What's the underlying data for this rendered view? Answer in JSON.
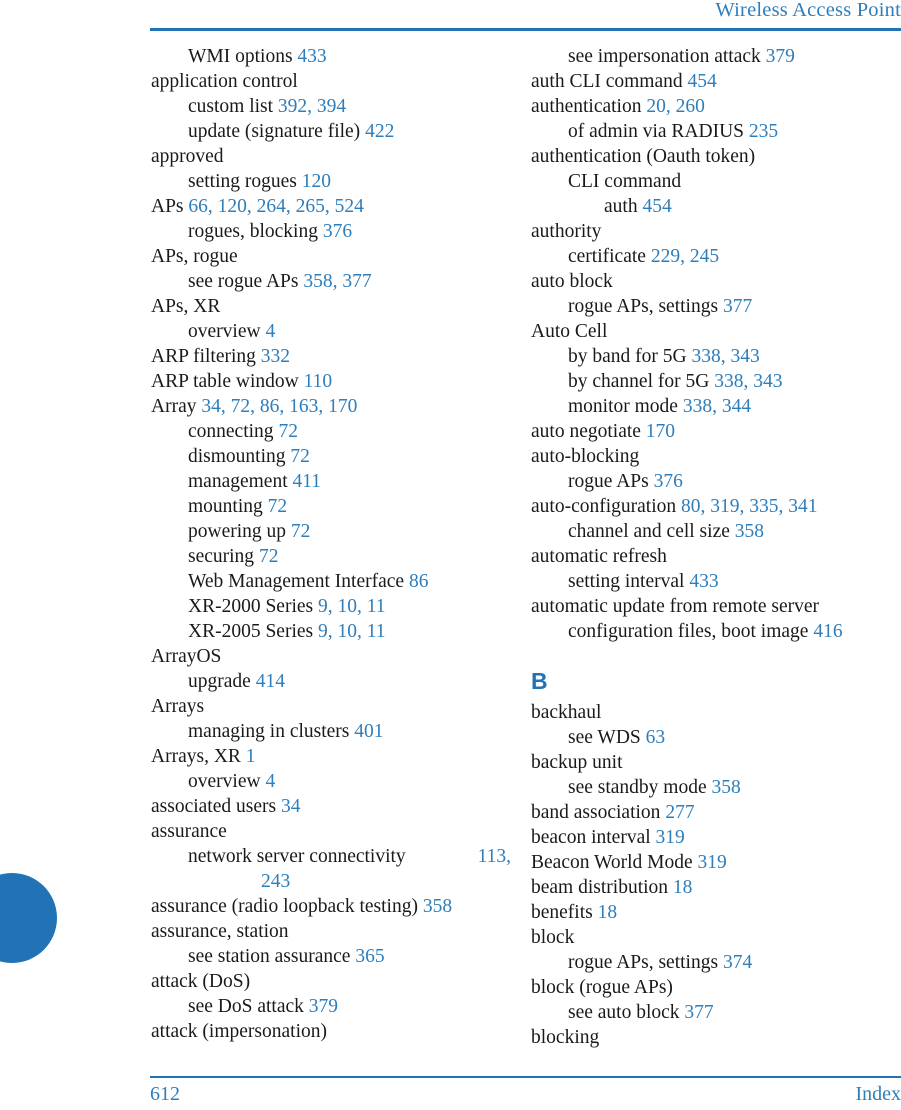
{
  "header": {
    "title": "Wireless Access Point"
  },
  "footer": {
    "page_number": "612",
    "label": "Index"
  },
  "colors": {
    "accent_blue": "#2273b5",
    "page_number_blue": "#2e7ebb",
    "body_text": "#1a1a1a"
  },
  "columns": {
    "left": [
      {
        "level": 1,
        "text": "WMI options ",
        "pages": "433"
      },
      {
        "level": 0,
        "text": "application control",
        "pages": ""
      },
      {
        "level": 1,
        "text": "custom list ",
        "pages": "392, 394"
      },
      {
        "level": 1,
        "text": "update (signature file) ",
        "pages": "422"
      },
      {
        "level": 0,
        "text": "approved",
        "pages": ""
      },
      {
        "level": 1,
        "text": "setting rogues ",
        "pages": "120"
      },
      {
        "level": 0,
        "text": "APs ",
        "pages": "66, 120, 264, 265, 524"
      },
      {
        "level": 1,
        "text": "rogues, blocking ",
        "pages": "376"
      },
      {
        "level": 0,
        "text": "APs, rogue",
        "pages": ""
      },
      {
        "level": 1,
        "text": "see rogue APs ",
        "pages": "358, 377"
      },
      {
        "level": 0,
        "text": "APs, XR",
        "pages": ""
      },
      {
        "level": 1,
        "text": "overview ",
        "pages": "4"
      },
      {
        "level": 0,
        "text": "ARP filtering ",
        "pages": "332"
      },
      {
        "level": 0,
        "text": "ARP table window ",
        "pages": "110"
      },
      {
        "level": 0,
        "text": "Array ",
        "pages": "34, 72, 86, 163, 170"
      },
      {
        "level": 1,
        "text": "connecting ",
        "pages": "72"
      },
      {
        "level": 1,
        "text": "dismounting ",
        "pages": "72"
      },
      {
        "level": 1,
        "text": "management ",
        "pages": "411"
      },
      {
        "level": 1,
        "text": "mounting ",
        "pages": "72"
      },
      {
        "level": 1,
        "text": "powering up ",
        "pages": "72"
      },
      {
        "level": 1,
        "text": "securing ",
        "pages": "72"
      },
      {
        "level": 1,
        "text": "Web Management Interface ",
        "pages": "86"
      },
      {
        "level": 1,
        "text": "XR-2000 Series ",
        "pages": "9, 10, 11"
      },
      {
        "level": 1,
        "text": "XR-2005 Series ",
        "pages": "9, 10, 11"
      },
      {
        "level": 0,
        "text": "ArrayOS",
        "pages": ""
      },
      {
        "level": 1,
        "text": "upgrade ",
        "pages": "414"
      },
      {
        "level": 0,
        "text": "Arrays",
        "pages": ""
      },
      {
        "level": 1,
        "text": "managing in clusters ",
        "pages": "401"
      },
      {
        "level": 0,
        "text": "Arrays, XR ",
        "pages": "1"
      },
      {
        "level": 1,
        "text": "overview ",
        "pages": "4"
      },
      {
        "level": 0,
        "text": "associated users ",
        "pages": "34"
      },
      {
        "level": 0,
        "text": "assurance",
        "pages": ""
      },
      {
        "level": 1,
        "justified": true,
        "text": "network server connectivity ",
        "pages": "113,",
        "continuation": "243"
      },
      {
        "level": 0,
        "text": "assurance (radio loopback testing) ",
        "pages": "358"
      },
      {
        "level": 0,
        "text": "assurance, station",
        "pages": ""
      },
      {
        "level": 1,
        "text": "see station assurance ",
        "pages": "365"
      },
      {
        "level": 0,
        "text": "attack (DoS)",
        "pages": ""
      },
      {
        "level": 1,
        "text": "see DoS attack ",
        "pages": "379"
      },
      {
        "level": 0,
        "text": "attack (impersonation)",
        "pages": ""
      }
    ],
    "right": [
      {
        "level": 1,
        "text": "see impersonation attack ",
        "pages": "379"
      },
      {
        "level": 0,
        "text": "auth CLI command ",
        "pages": "454"
      },
      {
        "level": 0,
        "text": "authentication ",
        "pages": "20, 260"
      },
      {
        "level": 1,
        "text": "of admin via RADIUS ",
        "pages": "235"
      },
      {
        "level": 0,
        "text": "authentication (Oauth token)",
        "pages": ""
      },
      {
        "level": 1,
        "text": "CLI command",
        "pages": ""
      },
      {
        "level": 2,
        "text": "auth ",
        "pages": "454"
      },
      {
        "level": 0,
        "text": "authority",
        "pages": ""
      },
      {
        "level": 1,
        "text": "certificate ",
        "pages": "229, 245"
      },
      {
        "level": 0,
        "text": "auto block",
        "pages": ""
      },
      {
        "level": 1,
        "text": "rogue APs, settings ",
        "pages": "377"
      },
      {
        "level": 0,
        "text": "Auto Cell",
        "pages": ""
      },
      {
        "level": 1,
        "text": "by band for 5G ",
        "pages": "338, 343"
      },
      {
        "level": 1,
        "text": "by channel for 5G ",
        "pages": "338, 343"
      },
      {
        "level": 1,
        "text": "monitor mode ",
        "pages": "338, 344"
      },
      {
        "level": 0,
        "text": "auto negotiate ",
        "pages": "170"
      },
      {
        "level": 0,
        "text": "auto-blocking",
        "pages": ""
      },
      {
        "level": 1,
        "text": "rogue APs ",
        "pages": "376"
      },
      {
        "level": 0,
        "text": "auto-configuration ",
        "pages": "80, 319, 335, 341"
      },
      {
        "level": 1,
        "text": "channel and cell size ",
        "pages": "358"
      },
      {
        "level": 0,
        "text": "automatic refresh",
        "pages": ""
      },
      {
        "level": 1,
        "text": "setting interval ",
        "pages": "433"
      },
      {
        "level": 0,
        "text": "automatic update from remote server",
        "pages": ""
      },
      {
        "level": 1,
        "text": "configuration files, boot image ",
        "pages": "416"
      },
      {
        "section": "B"
      },
      {
        "level": 0,
        "text": "backhaul",
        "pages": ""
      },
      {
        "level": 1,
        "text": "see WDS ",
        "pages": "63"
      },
      {
        "level": 0,
        "text": "backup unit",
        "pages": ""
      },
      {
        "level": 1,
        "text": "see standby mode ",
        "pages": "358"
      },
      {
        "level": 0,
        "text": "band association ",
        "pages": "277"
      },
      {
        "level": 0,
        "text": "beacon interval ",
        "pages": "319"
      },
      {
        "level": 0,
        "text": "Beacon World Mode ",
        "pages": "319"
      },
      {
        "level": 0,
        "text": "beam distribution ",
        "pages": "18"
      },
      {
        "level": 0,
        "text": "benefits ",
        "pages": "18"
      },
      {
        "level": 0,
        "text": "block",
        "pages": ""
      },
      {
        "level": 1,
        "text": "rogue APs, settings ",
        "pages": "374"
      },
      {
        "level": 0,
        "text": "block (rogue APs)",
        "pages": ""
      },
      {
        "level": 1,
        "text": "see auto block ",
        "pages": "377"
      },
      {
        "level": 0,
        "text": "blocking",
        "pages": ""
      }
    ]
  }
}
